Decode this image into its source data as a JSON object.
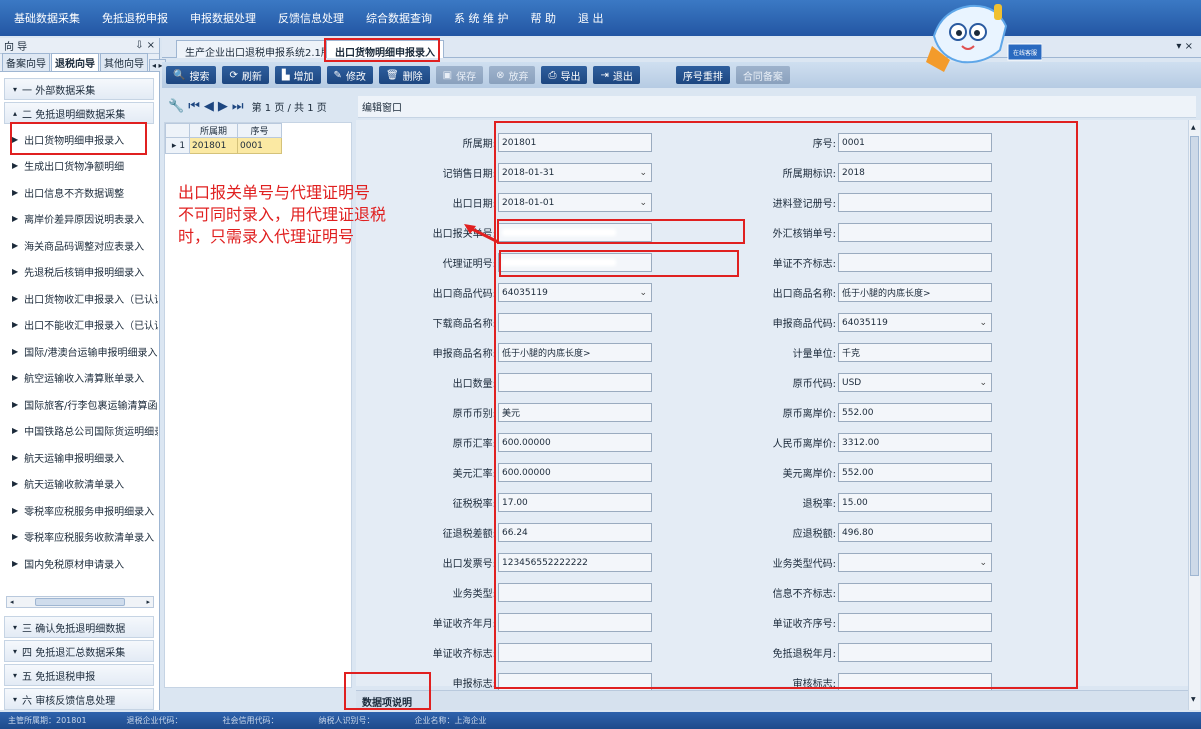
{
  "menu": [
    "基础数据采集",
    "免抵退税申报",
    "申报数据处理",
    "反馈信息处理",
    "综合数据查询",
    "系 统 维 护",
    "帮 助",
    "退 出"
  ],
  "mascot_label": "在线客服",
  "left_panel": {
    "title": "向 导",
    "title_controls": "⇩ ×",
    "tabs": [
      "备案向导",
      "退税向导",
      "其他向导",
      "◂ ▸"
    ],
    "groups_top": [
      {
        "label": "一 外部数据采集",
        "toggle": "▾"
      },
      {
        "label": "二 免抵退明细数据采集",
        "toggle": "▴"
      }
    ],
    "items": [
      "出口货物明细申报录入",
      "生成出口货物净额明细",
      "出口信息不齐数据调整",
      "离岸价差异原因说明表录入",
      "海关商品码调整对应表录入",
      "先退税后核销申报明细录入",
      "出口货物收汇申报录入（已认证",
      "出口不能收汇申报录入（已认证",
      "国际/港澳台运输申报明细录入",
      "航空运输收入清算账单录入",
      "国际旅客/行李包裹运输清算函",
      "中国铁路总公司国际货运明细录",
      "航天运输申报明细录入",
      "航天运输收款清单录入",
      "零税率应税服务申报明细录入",
      "零税率应税服务收款清单录入",
      "国内免税原材申请录入"
    ],
    "groups_bottom": [
      {
        "label": "三 确认免抵退明细数据",
        "toggle": "▾"
      },
      {
        "label": "四 免抵退汇总数据采集",
        "toggle": "▾"
      },
      {
        "label": "五 免抵退税申报",
        "toggle": "▾"
      },
      {
        "label": "六 审核反馈信息处理",
        "toggle": "▾"
      }
    ]
  },
  "doc_tabs": [
    "生产企业出口退税申报系统2.1版",
    "出口货物明细申报录入"
  ],
  "close_all": "▾ ×",
  "toolbar": [
    {
      "icon": "🔍",
      "label": "搜索",
      "enabled": true
    },
    {
      "icon": "⟳",
      "label": "刷新",
      "enabled": true
    },
    {
      "icon": "▙",
      "label": "增加",
      "enabled": true
    },
    {
      "icon": "✎",
      "label": "修改",
      "enabled": true
    },
    {
      "icon": "🗑",
      "label": "删除",
      "enabled": true
    },
    {
      "icon": "▣",
      "label": "保存",
      "enabled": false
    },
    {
      "icon": "⊗",
      "label": "放弃",
      "enabled": false
    },
    {
      "icon": "⎙",
      "label": "导出",
      "enabled": true
    },
    {
      "icon": "⇥",
      "label": "退出",
      "enabled": true
    },
    {
      "icon": "",
      "label": "序号重排",
      "enabled": true
    },
    {
      "icon": "",
      "label": "合同备案",
      "enabled": false
    }
  ],
  "pager": {
    "first": "⏮",
    "prev": "◀",
    "next": "▶",
    "last": "⏭",
    "text": "第 1 页 / 共 1 页"
  },
  "grid": {
    "headers": [
      "所属期",
      "序号"
    ],
    "rows": [
      {
        "marker": "▸",
        "num": "1",
        "period": "201801",
        "seq": "0001"
      }
    ]
  },
  "edit_label": "编辑窗口",
  "form_left": [
    {
      "label": "所属期:",
      "value": "201801",
      "dropdown": false
    },
    {
      "label": "记销售日期:",
      "value": "2018-01-31",
      "dropdown": true
    },
    {
      "label": "出口日期:",
      "value": "2018-01-01",
      "dropdown": true
    },
    {
      "label": "出口报关单号:",
      "value": "",
      "dropdown": false,
      "redacted": true
    },
    {
      "label": "代理证明号:",
      "value": "",
      "dropdown": false,
      "redacted": true
    },
    {
      "label": "出口商品代码:",
      "value": "64035119",
      "dropdown": true
    },
    {
      "label": "下载商品名称:",
      "value": "",
      "dropdown": false
    },
    {
      "label": "申报商品名称:",
      "value": "低于小腿的内底长度>",
      "dropdown": false
    },
    {
      "label": "出口数量:",
      "value": "",
      "dropdown": false
    },
    {
      "label": "原币币别:",
      "value": "美元",
      "dropdown": false
    },
    {
      "label": "原币汇率:",
      "value": "600.00000",
      "dropdown": false
    },
    {
      "label": "美元汇率:",
      "value": "600.00000",
      "dropdown": false
    },
    {
      "label": "征税税率:",
      "value": "17.00",
      "dropdown": false
    },
    {
      "label": "征退税差额:",
      "value": "66.24",
      "dropdown": false
    },
    {
      "label": "出口发票号:",
      "value": "123456552222222",
      "dropdown": false
    },
    {
      "label": "业务类型:",
      "value": "",
      "dropdown": false
    },
    {
      "label": "单证收齐年月:",
      "value": "",
      "dropdown": false
    },
    {
      "label": "单证收齐标志:",
      "value": "",
      "dropdown": false
    },
    {
      "label": "申报标志:",
      "value": "",
      "dropdown": false
    }
  ],
  "form_right": [
    {
      "label": "序号:",
      "value": "0001",
      "dropdown": false
    },
    {
      "label": "所属期标识:",
      "value": "2018",
      "dropdown": false
    },
    {
      "label": "进料登记册号:",
      "value": "",
      "dropdown": false
    },
    {
      "label": "外汇核销单号:",
      "value": "",
      "dropdown": false
    },
    {
      "label": "单证不齐标志:",
      "value": "",
      "dropdown": false
    },
    {
      "label": "出口商品名称:",
      "value": "低于小腿的内底长度>",
      "dropdown": false
    },
    {
      "label": "申报商品代码:",
      "value": "64035119",
      "dropdown": true
    },
    {
      "label": "计量单位:",
      "value": "千克",
      "dropdown": false
    },
    {
      "label": "原币代码:",
      "value": "USD",
      "dropdown": true
    },
    {
      "label": "原币离岸价:",
      "value": "552.00",
      "dropdown": false
    },
    {
      "label": "人民币离岸价:",
      "value": "3312.00",
      "dropdown": false
    },
    {
      "label": "美元离岸价:",
      "value": "552.00",
      "dropdown": false
    },
    {
      "label": "退税率:",
      "value": "15.00",
      "dropdown": false
    },
    {
      "label": "应退税额:",
      "value": "496.80",
      "dropdown": false
    },
    {
      "label": "业务类型代码:",
      "value": "",
      "dropdown": true
    },
    {
      "label": "信息不齐标志:",
      "value": "",
      "dropdown": false
    },
    {
      "label": "单证收齐序号:",
      "value": "",
      "dropdown": false
    },
    {
      "label": "免抵退税年月:",
      "value": "",
      "dropdown": false
    },
    {
      "label": "审核标志:",
      "value": "",
      "dropdown": false
    }
  ],
  "annotation": [
    "出口报关单号与代理证明号",
    "不可同时录入，用代理证退税",
    "时，只需录入代理证明号"
  ],
  "bottom_tab": "数据项说明",
  "status_items": [
    "主管所属期：201801",
    "退税企业代码：",
    "社会信用代码：",
    "纳税人识别号：",
    "企业名称：上海企业"
  ],
  "colors": {
    "accent": "#2356a3",
    "highlight_frame": "#e02020",
    "selected_row": "#fbe9a3"
  }
}
